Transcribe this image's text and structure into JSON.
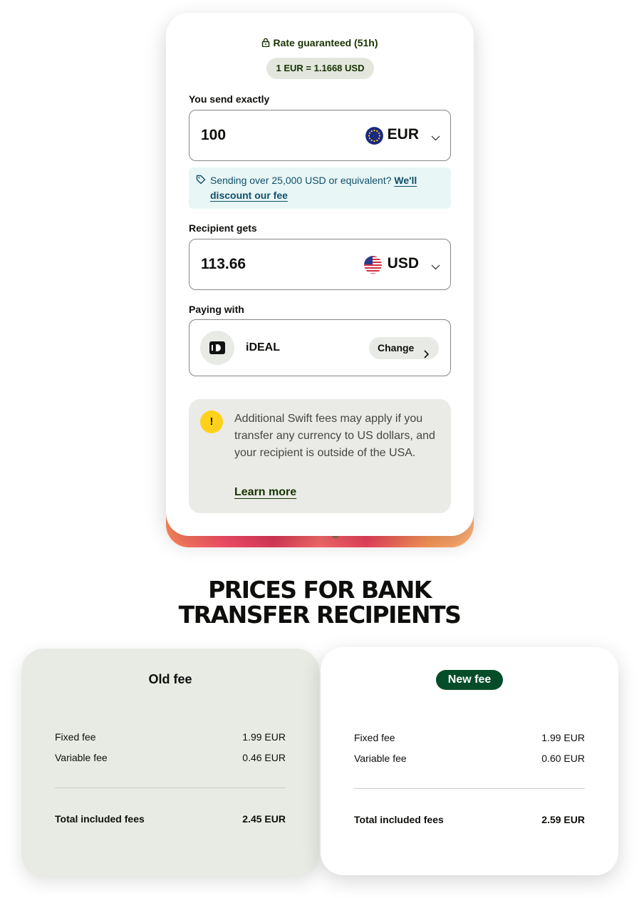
{
  "calculator": {
    "rate_guaranteed": "Rate guaranteed (51h)",
    "rate": "1 EUR = 1.1668 USD",
    "send_label": "You send exactly",
    "send_amount": "100",
    "send_currency": "EUR",
    "discount_text": "Sending over 25,000 USD or equivalent?",
    "discount_link": "We'll discount our fee",
    "receive_label": "Recipient gets",
    "receive_amount": "113.66",
    "receive_currency": "USD",
    "paying_label": "Paying with",
    "payment_method": "iDEAL",
    "change_label": "Change",
    "warning_text": "Additional Swift fees may apply if you transfer any currency to US dollars, and your recipient is outside of the USA.",
    "learn_more": "Learn more"
  },
  "heading": {
    "line1": "PRICES FOR BANK",
    "line2": "TRANSFER RECIPIENTS"
  },
  "old_fee": {
    "title": "Old fee",
    "fixed_label": "Fixed fee",
    "fixed_value": "1.99 EUR",
    "variable_label": "Variable fee",
    "variable_value": "0.46 EUR",
    "total_label": "Total included fees",
    "total_value": "2.45 EUR"
  },
  "new_fee": {
    "title": "New fee",
    "fixed_label": "Fixed fee",
    "fixed_value": "1.99 EUR",
    "variable_label": "Variable fee",
    "variable_value": "0.60 EUR",
    "total_label": "Total included fees",
    "total_value": "2.59 EUR"
  },
  "icons": {
    "lock": "lock-icon",
    "eur_flag": "eu-flag-icon",
    "usd_flag": "us-flag-icon",
    "chevron": "chevron-down-icon",
    "tag": "tag-icon",
    "ideal": "ideal-icon",
    "warning": "exclamation-icon"
  },
  "colors": {
    "brand_green": "#163300",
    "pill_green": "#054d28",
    "warning_yellow": "#ffd11a",
    "info_bg": "#e8f6f5"
  }
}
